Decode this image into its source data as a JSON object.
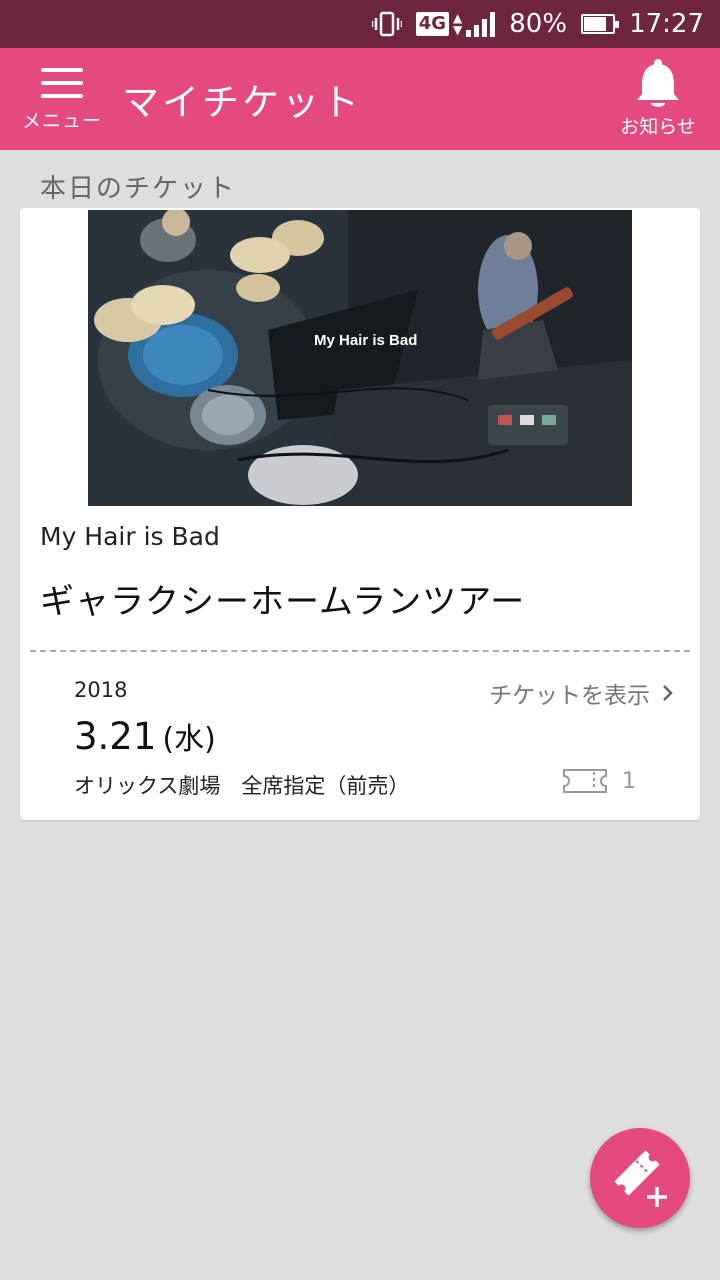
{
  "status_bar": {
    "network": "4G",
    "battery": "80%",
    "battery_level": 0.8,
    "time": "17:27",
    "icons": [
      "vibrate-icon",
      "network-type-icon",
      "data-activity-icon",
      "signal-icon",
      "battery-icon"
    ]
  },
  "app_bar": {
    "menu_label": "メニュー",
    "title": "マイチケット",
    "notice_label": "お知らせ",
    "background": "#e4497f"
  },
  "section": {
    "label": "本日のチケット"
  },
  "ticket": {
    "banner_logo": "My Hair is Bad",
    "artist": "My Hair is Bad",
    "tour": "ギャラクシーホームランツアー",
    "year": "2018",
    "date": "3.21",
    "weekday": "(水)",
    "venue": "オリックス劇場　全席指定（前売）",
    "show_ticket_label": "チケットを表示",
    "count": "1"
  },
  "fab": {
    "icon": "add-ticket-icon",
    "color": "#e4497f"
  }
}
